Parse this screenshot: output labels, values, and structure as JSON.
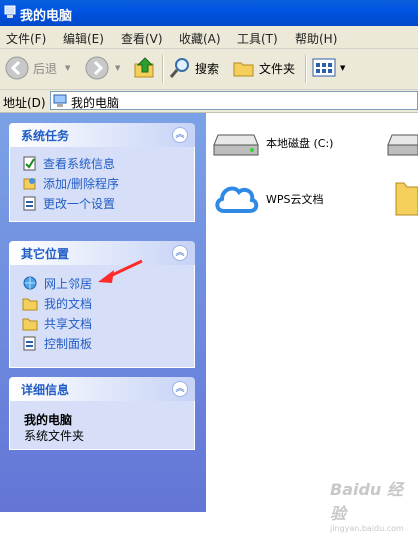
{
  "window": {
    "title": "我的电脑"
  },
  "menu": [
    "文件(F)",
    "编辑(E)",
    "查看(V)",
    "收藏(A)",
    "工具(T)",
    "帮助(H)"
  ],
  "toolbar": {
    "back_label": "后退",
    "search_label": "搜索",
    "folders_label": "文件夹"
  },
  "address": {
    "label": "地址(D)",
    "value": "我的电脑"
  },
  "panels": {
    "system_tasks": {
      "title": "系统任务",
      "items": [
        "查看系统信息",
        "添加/删除程序",
        "更改一个设置"
      ]
    },
    "other_places": {
      "title": "其它位置",
      "items": [
        "网上邻居",
        "我的文档",
        "共享文档",
        "控制面板"
      ]
    },
    "details": {
      "title": "详细信息",
      "name": "我的电脑",
      "type": "系统文件夹"
    }
  },
  "content": {
    "items": [
      {
        "label": "本地磁盘 (C:)"
      },
      {
        "label": "WPS云文档"
      }
    ]
  },
  "watermark": {
    "text": "Baidu 经验",
    "sub": "jingyan.baidu.com"
  },
  "colors": {
    "title_bar": "#0054e3",
    "task_pane": "#6375d6",
    "link": "#215dc6",
    "annotation_arrow": "#ff2a2a"
  }
}
